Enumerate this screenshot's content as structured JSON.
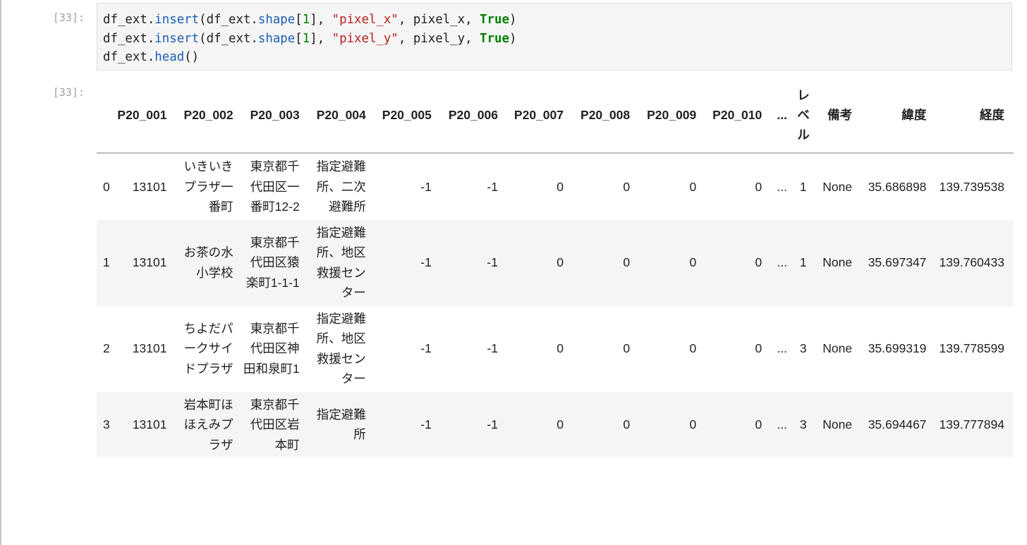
{
  "cell_input": {
    "prompt": "[33]:",
    "code_tokens": [
      [
        [
          "df_ext.",
          ""
        ],
        [
          "insert",
          "fn"
        ],
        [
          "(df_ext.",
          ""
        ],
        [
          "shape",
          "fn"
        ],
        [
          "[",
          ""
        ],
        [
          "1",
          "num"
        ],
        [
          "], ",
          ""
        ],
        [
          "\"pixel_x\"",
          "str"
        ],
        [
          ", pixel_x, ",
          ""
        ],
        [
          "True",
          "bool"
        ],
        [
          ")",
          ""
        ]
      ],
      [
        [
          "df_ext.",
          ""
        ],
        [
          "insert",
          "fn"
        ],
        [
          "(df_ext.",
          ""
        ],
        [
          "shape",
          "fn"
        ],
        [
          "[",
          ""
        ],
        [
          "1",
          "num"
        ],
        [
          "], ",
          ""
        ],
        [
          "\"pixel_y\"",
          "str"
        ],
        [
          ", pixel_y, ",
          ""
        ],
        [
          "True",
          "bool"
        ],
        [
          ")",
          ""
        ]
      ],
      [
        [
          "df_ext.",
          ""
        ],
        [
          "head",
          "fn"
        ],
        [
          "()",
          ""
        ]
      ]
    ]
  },
  "cell_output": {
    "prompt": "[33]:",
    "headers": [
      "",
      "P20_001",
      "P20_002",
      "P20_003",
      "P20_004",
      "P20_005",
      "P20_006",
      "P20_007",
      "P20_008",
      "P20_009",
      "P20_010",
      "...",
      "レベル",
      "備考",
      "緯度",
      "経度"
    ],
    "rows": [
      [
        "0",
        "13101",
        "いきいきプラザ一番町",
        "東京都千代田区一番町12-2",
        "指定避難所、二次避難所",
        "-1",
        "-1",
        "0",
        "0",
        "0",
        "0",
        "...",
        "1",
        "None",
        "35.686898",
        "139.739538"
      ],
      [
        "1",
        "13101",
        "お茶の水小学校",
        "東京都千代田区猿楽町1-1-1",
        "指定避難所、地区救援センター",
        "-1",
        "-1",
        "0",
        "0",
        "0",
        "0",
        "...",
        "1",
        "None",
        "35.697347",
        "139.760433"
      ],
      [
        "2",
        "13101",
        "ちよだパークサイドプラザ",
        "東京都千代田区神田和泉町1",
        "指定避難所、地区救援センター",
        "-1",
        "-1",
        "0",
        "0",
        "0",
        "0",
        "...",
        "3",
        "None",
        "35.699319",
        "139.778599"
      ],
      [
        "3",
        "13101",
        "岩本町ほほえみプラザ",
        "東京都千代田区岩本町",
        "指定避難所",
        "-1",
        "-1",
        "0",
        "0",
        "0",
        "0",
        "...",
        "3",
        "None",
        "35.694467",
        "139.777894"
      ]
    ]
  }
}
